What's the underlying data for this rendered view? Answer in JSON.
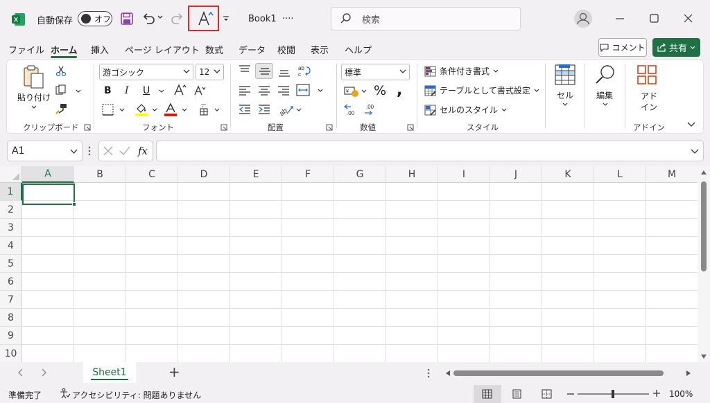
{
  "titlebar": {
    "autosave_label": "自動保存",
    "autosave_state": "オフ",
    "book_name": "Book1",
    "book_suffix": "····",
    "search_placeholder": "検索"
  },
  "menu": {
    "tabs": [
      "ファイル",
      "ホーム",
      "挿入",
      "ページ レイアウト",
      "数式",
      "データ",
      "校閲",
      "表示",
      "ヘルプ"
    ],
    "active_tab": "ホーム",
    "comment_label": "コメント",
    "share_label": "共有"
  },
  "ribbon": {
    "clipboard": {
      "paste_label": "貼り付け",
      "group_label": "クリップボード"
    },
    "font": {
      "font_name": "游ゴシック",
      "font_size": "12",
      "group_label": "フォント"
    },
    "alignment": {
      "group_label": "配置"
    },
    "number": {
      "format": "標準",
      "group_label": "数値"
    },
    "styles": {
      "conditional": "条件付き書式",
      "table": "テーブルとして書式設定",
      "cell_styles": "セルのスタイル",
      "group_label": "スタイル"
    },
    "cells_label": "セル",
    "editing_label": "編集",
    "addin_label_1": "アド",
    "addin_label_2": "イン",
    "addin_group_label": "アドイン"
  },
  "formula_bar": {
    "name_box": "A1",
    "fx": "fx",
    "value": ""
  },
  "grid": {
    "columns": [
      "A",
      "B",
      "C",
      "D",
      "E",
      "F",
      "G",
      "H",
      "I",
      "J",
      "K",
      "L",
      "M"
    ],
    "rows": [
      "1",
      "2",
      "3",
      "4",
      "5",
      "6",
      "7",
      "8",
      "9",
      "10"
    ],
    "active_cell": "A1"
  },
  "sheets": {
    "tabs": [
      "Sheet1"
    ],
    "add_label": "+"
  },
  "status": {
    "ready": "準備完了",
    "accessibility": "アクセシビリティ: 問題ありません",
    "zoom": "100%"
  },
  "colors": {
    "accent": "#1e7145",
    "highlight_box": "#e8232b"
  }
}
